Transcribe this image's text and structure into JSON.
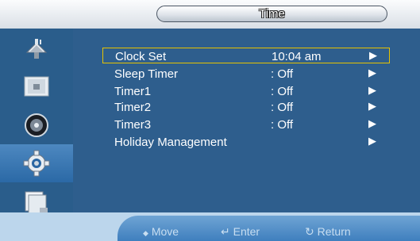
{
  "title": "Time",
  "sidebar": {
    "items": [
      {
        "icon": "satellite-dish-icon"
      },
      {
        "icon": "picture-icon"
      },
      {
        "icon": "speaker-icon"
      },
      {
        "icon": "gear-icon",
        "active": true
      },
      {
        "icon": "pages-icon"
      }
    ]
  },
  "menu": {
    "rows": [
      {
        "label": "Clock Set",
        "value": "10:04 am",
        "arrow": "▶",
        "selected": true
      },
      {
        "label": "Sleep Timer",
        "value": ": Off",
        "arrow": "▶"
      },
      {
        "label": "Timer1",
        "value": ": Off",
        "arrow": "▶"
      },
      {
        "label": "Timer2",
        "value": ": Off",
        "arrow": "▶"
      },
      {
        "label": "Timer3",
        "value": ": Off",
        "arrow": "▶"
      },
      {
        "label": "Holiday Management",
        "value": "",
        "arrow": "▶"
      }
    ]
  },
  "footer": {
    "move_icon": "◆",
    "move": "Move",
    "enter_icon": "↵",
    "enter": "Enter",
    "return_icon": "↻",
    "return": "Return"
  },
  "colors": {
    "panel": "#2e5e8d",
    "sidebar": "#2a5d8b",
    "selection_border": "#e6c200",
    "footer": "#4f8bc6"
  }
}
